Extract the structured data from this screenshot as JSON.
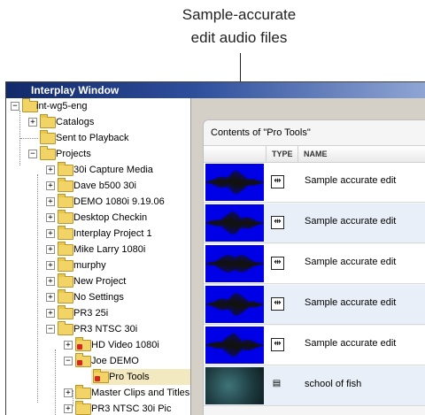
{
  "callout": {
    "line1": "Sample-accurate",
    "line2": "edit audio files"
  },
  "window": {
    "title": "Interplay Window"
  },
  "tree": {
    "root": "int-wg5-eng",
    "items": [
      {
        "label": "Catalogs"
      },
      {
        "label": "Sent to Playback"
      },
      {
        "label": "Projects"
      },
      {
        "label": "30i Capture Media"
      },
      {
        "label": "Dave b500 30i"
      },
      {
        "label": "DEMO 1080i 9.19.06"
      },
      {
        "label": "Desktop Checkin"
      },
      {
        "label": "Interplay Project 1"
      },
      {
        "label": "Mike Larry 1080i"
      },
      {
        "label": "murphy"
      },
      {
        "label": "New Project"
      },
      {
        "label": "No Settings"
      },
      {
        "label": "PR3 25i"
      },
      {
        "label": "PR3 NTSC 30i"
      },
      {
        "label": "HD Video 1080i"
      },
      {
        "label": "Joe DEMO"
      },
      {
        "label": "Pro Tools"
      },
      {
        "label": "Master Clips and Titles"
      },
      {
        "label": "PR3 NTSC 30i Pic"
      }
    ]
  },
  "contents": {
    "title": "Contents of \"Pro Tools\"",
    "columns": {
      "type": "TYPE",
      "name": "NAME"
    },
    "rows": [
      {
        "type_icon": "audio-icon",
        "name": "Sample accurate edit"
      },
      {
        "type_icon": "audio-icon",
        "name": "Sample accurate edit"
      },
      {
        "type_icon": "audio-icon",
        "name": "Sample accurate edit"
      },
      {
        "type_icon": "audio-icon",
        "name": "Sample accurate edit"
      },
      {
        "type_icon": "audio-icon",
        "name": "Sample accurate edit"
      },
      {
        "type_icon": "video-icon",
        "name": "school of fish"
      }
    ]
  }
}
